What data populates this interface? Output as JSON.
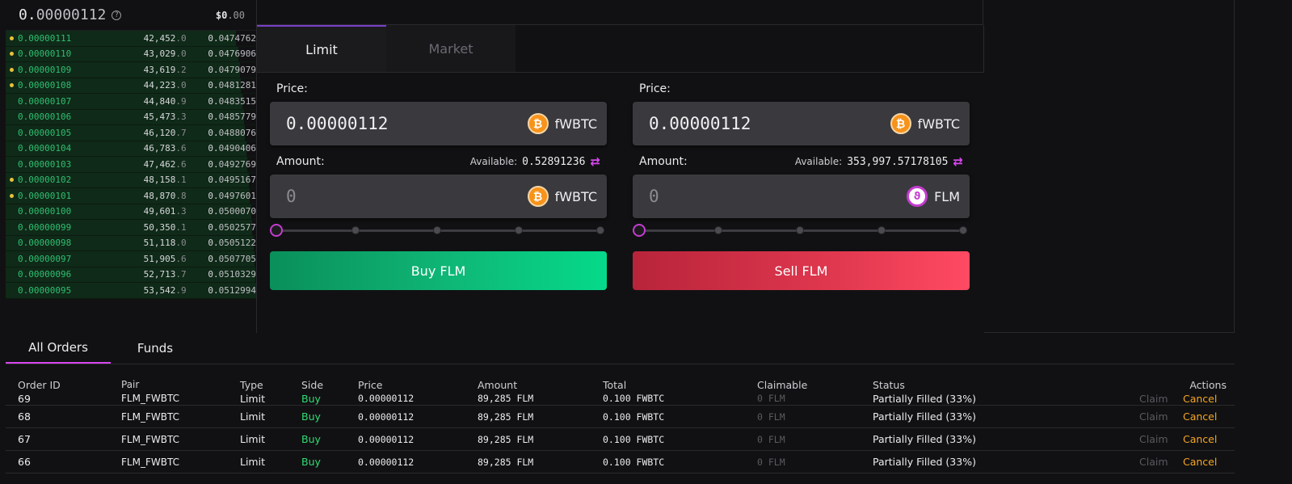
{
  "orderbook": {
    "last_price_int": "0.",
    "last_price_frac": "00000112",
    "usd_main": "$0",
    "usd_frac": ".00",
    "rows": [
      {
        "mine": true,
        "price": "0.00000111",
        "amount": "42,452",
        "amount_dec": ".0",
        "total_int": "0.",
        "total_frac": "0474762",
        "fill": 0.92
      },
      {
        "mine": true,
        "price": "0.00000110",
        "amount": "43,029",
        "amount_dec": ".0",
        "total_int": "0.",
        "total_frac": "0476906",
        "fill": 0.93
      },
      {
        "mine": true,
        "price": "0.00000109",
        "amount": "43,619",
        "amount_dec": ".2",
        "total_int": "0.",
        "total_frac": "0479079",
        "fill": 0.935
      },
      {
        "mine": true,
        "price": "0.00000108",
        "amount": "44,223",
        "amount_dec": ".0",
        "total_int": "0.",
        "total_frac": "0481281",
        "fill": 0.94
      },
      {
        "mine": false,
        "price": "0.00000107",
        "amount": "44,840",
        "amount_dec": ".9",
        "total_int": "0.",
        "total_frac": "0483515",
        "fill": 0.945
      },
      {
        "mine": false,
        "price": "0.00000106",
        "amount": "45,473",
        "amount_dec": ".3",
        "total_int": "0.",
        "total_frac": "0485779",
        "fill": 0.95
      },
      {
        "mine": false,
        "price": "0.00000105",
        "amount": "46,120",
        "amount_dec": ".7",
        "total_int": "0.",
        "total_frac": "0488076",
        "fill": 0.955
      },
      {
        "mine": false,
        "price": "0.00000104",
        "amount": "46,783",
        "amount_dec": ".6",
        "total_int": "0.",
        "total_frac": "0490406",
        "fill": 0.96
      },
      {
        "mine": false,
        "price": "0.00000103",
        "amount": "47,462",
        "amount_dec": ".6",
        "total_int": "0.",
        "total_frac": "0492769",
        "fill": 0.965
      },
      {
        "mine": true,
        "price": "0.00000102",
        "amount": "48,158",
        "amount_dec": ".1",
        "total_int": "0.",
        "total_frac": "0495167",
        "fill": 0.97
      },
      {
        "mine": true,
        "price": "0.00000101",
        "amount": "48,870",
        "amount_dec": ".8",
        "total_int": "0.",
        "total_frac": "0497601",
        "fill": 0.975
      },
      {
        "mine": false,
        "price": "0.00000100",
        "amount": "49,601",
        "amount_dec": ".3",
        "total_int": "0.",
        "total_frac": "0500070",
        "fill": 0.98
      },
      {
        "mine": false,
        "price": "0.00000099",
        "amount": "50,350",
        "amount_dec": ".1",
        "total_int": "0.",
        "total_frac": "0502577",
        "fill": 0.985
      },
      {
        "mine": false,
        "price": "0.00000098",
        "amount": "51,118",
        "amount_dec": ".0",
        "total_int": "0.",
        "total_frac": "0505122",
        "fill": 0.99
      },
      {
        "mine": false,
        "price": "0.00000097",
        "amount": "51,905",
        "amount_dec": ".6",
        "total_int": "0.",
        "total_frac": "0507705",
        "fill": 0.993
      },
      {
        "mine": false,
        "price": "0.00000096",
        "amount": "52,713",
        "amount_dec": ".7",
        "total_int": "0.",
        "total_frac": "0510329",
        "fill": 0.997
      },
      {
        "mine": false,
        "price": "0.00000095",
        "amount": "53,542",
        "amount_dec": ".9",
        "total_int": "0.",
        "total_frac": "0512994",
        "fill": 1.0
      }
    ]
  },
  "trade": {
    "tabs": [
      {
        "label": "Limit",
        "active": true
      },
      {
        "label": "Market",
        "active": false
      }
    ],
    "buy": {
      "price_label": "Price:",
      "price_value": "0.00000112",
      "price_token": "fWBTC",
      "amount_label": "Amount:",
      "available_label": "Available:",
      "available_value": "0.52891236",
      "amount_placeholder": "0",
      "amount_token": "fWBTC",
      "slider_percent": 0,
      "button_label": "Buy FLM"
    },
    "sell": {
      "price_label": "Price:",
      "price_value": "0.00000112",
      "price_token": "fWBTC",
      "amount_label": "Amount:",
      "available_label": "Available:",
      "available_value": "353,997.57178105",
      "amount_placeholder": "0",
      "amount_token": "FLM",
      "slider_percent": 0,
      "button_label": "Sell FLM"
    }
  },
  "orders": {
    "tabs": [
      {
        "label": "All Orders",
        "active": true
      },
      {
        "label": "Funds",
        "active": false
      }
    ],
    "headers": {
      "id": "Order ID",
      "pair": "Pair",
      "type": "Type",
      "side": "Side",
      "price": "Price",
      "amount": "Amount",
      "total": "Total",
      "claimable": "Claimable",
      "status": "Status",
      "actions": "Actions"
    },
    "rows": [
      {
        "id": "69",
        "pair": "FLM_FWBTC",
        "type": "Limit",
        "side": "Buy",
        "price": "0.00000112",
        "amount": "89,285 FLM",
        "total": "0.100 FWBTC",
        "claimable": "0 FLM",
        "status": "Partially Filled (33%)",
        "claim": "Claim",
        "cancel": "Cancel"
      },
      {
        "id": "68",
        "pair": "FLM_FWBTC",
        "type": "Limit",
        "side": "Buy",
        "price": "0.00000112",
        "amount": "89,285 FLM",
        "total": "0.100 FWBTC",
        "claimable": "0 FLM",
        "status": "Partially Filled (33%)",
        "claim": "Claim",
        "cancel": "Cancel"
      },
      {
        "id": "67",
        "pair": "FLM_FWBTC",
        "type": "Limit",
        "side": "Buy",
        "price": "0.00000112",
        "amount": "89,285 FLM",
        "total": "0.100 FWBTC",
        "claimable": "0 FLM",
        "status": "Partially Filled (33%)",
        "claim": "Claim",
        "cancel": "Cancel"
      },
      {
        "id": "66",
        "pair": "FLM_FWBTC",
        "type": "Limit",
        "side": "Buy",
        "price": "0.00000112",
        "amount": "89,285 FLM",
        "total": "0.100 FWBTC",
        "claimable": "0 FLM",
        "status": "Partially Filled (33%)",
        "claim": "Claim",
        "cancel": "Cancel"
      }
    ]
  },
  "colors": {
    "accent": "#d847f0",
    "buy": "#2fdc73",
    "sell": "#e0384f",
    "cancel": "#f5a623",
    "bid_price": "#2fbf71"
  },
  "icons": {
    "help": "help-circle-icon",
    "swap": "swap-arrows-icon",
    "btc": "bitcoin-token-icon",
    "flm": "flamingo-token-icon"
  }
}
